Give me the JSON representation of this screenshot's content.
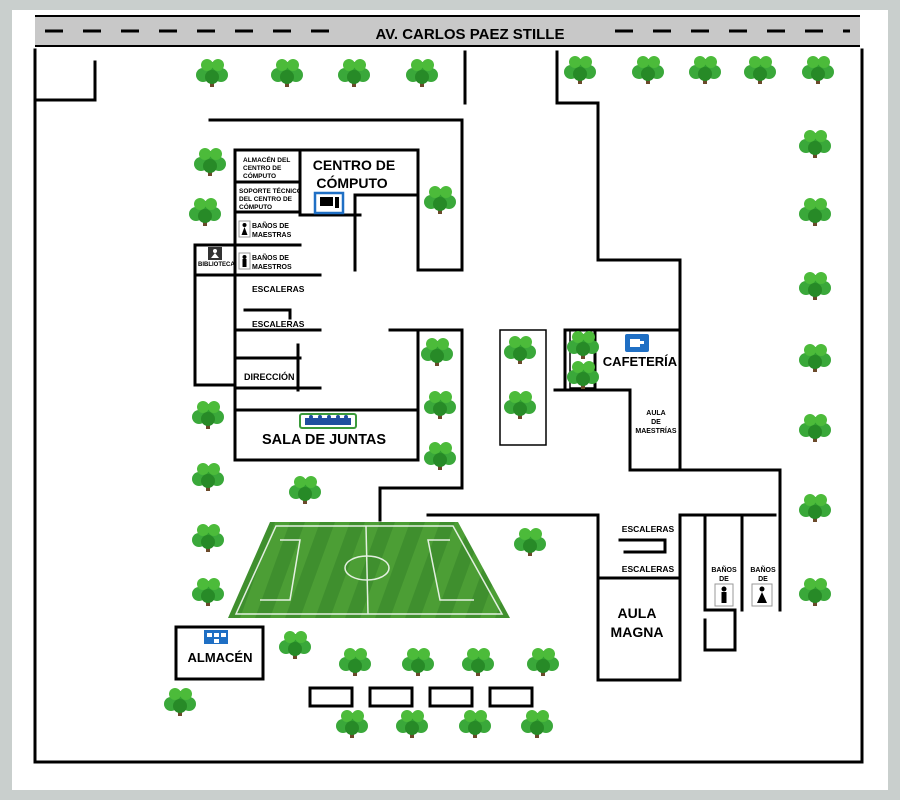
{
  "map": {
    "street_name": "AV. CARLOS PAEZ STILLE",
    "colors": {
      "border": "#c9cfcd",
      "ground": "#ffffff",
      "road": "#c8c8c8",
      "tree": "#2f9e2f",
      "field": "#3f8f2e",
      "icon_blue": "#1f6fc4"
    },
    "rooms": {
      "centro_computo": "CENTRO DE CÓMPUTO",
      "almacen_cc": "ALMACÉN DEL CENTRO DE CÓMPUTO",
      "soporte_cc": "SOPORTE TÉCNICO DEL CENTRO DE CÓMPUTO",
      "banos_maestras_1": "BAÑOS DE MAESTRAS",
      "banos_maestros": "BAÑOS DE MAESTROS",
      "biblioteca": "BIBLIOTECA",
      "escaleras_1": "ESCALERAS",
      "escaleras_2": "ESCALERAS",
      "direccion": "DIRECCIÓN",
      "sala_juntas": "SALA DE JUNTAS",
      "cafeteria": "CAFETERÍA",
      "aula_maestrias": "AULA DE MAESTRÍAS",
      "escaleras_3": "ESCALERAS",
      "escaleras_4": "ESCALERAS",
      "aula_magna": "AULA MAGNA",
      "banos_de_1": "BAÑOS DE",
      "banos_de_2": "BAÑOS DE",
      "almacen": "ALMACÉN"
    },
    "icons": [
      "computer-icon",
      "library-icon",
      "male-restroom-icon",
      "female-restroom-icon",
      "meeting-room-icon",
      "coffee-cup-icon",
      "warehouse-icon",
      "soccer-field"
    ]
  }
}
